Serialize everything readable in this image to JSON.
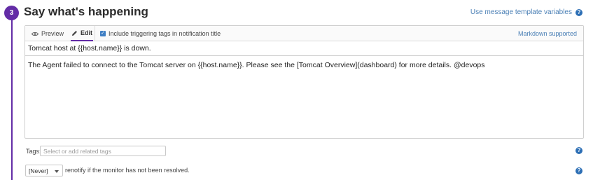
{
  "step": {
    "number": "3",
    "title": "Say what's happening"
  },
  "template_link": "Use message template variables",
  "editor": {
    "tabs": {
      "preview": "Preview",
      "edit": "Edit"
    },
    "include_tags_label": "Include triggering tags in notification title",
    "include_tags_checked": true,
    "markdown_label": "Markdown supported",
    "title_value": "Tomcat host at {{host.name}} is down.",
    "body_value": "The Agent failed to connect to the Tomcat server on {{host.name}}. Please see the [Tomcat Overview](dashboard) for more details. @devops"
  },
  "tags": {
    "label": "Tags:",
    "placeholder": "Select or add related tags"
  },
  "renotify": {
    "selected": "[Never]",
    "text": "renotify if the monitor has not been resolved."
  },
  "colors": {
    "accent": "#632ca6",
    "link": "#4a7fb5",
    "help": "#2d6fb5"
  },
  "icons": {
    "help": "?"
  }
}
